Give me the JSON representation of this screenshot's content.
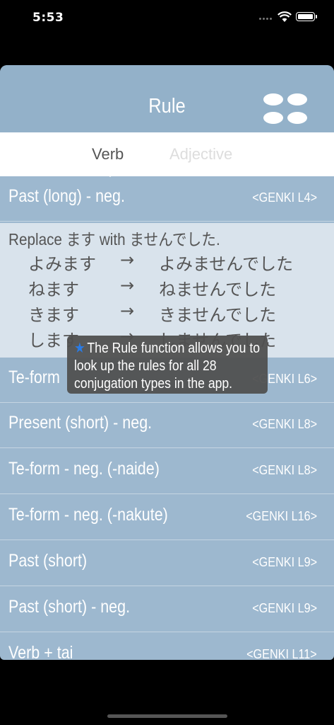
{
  "status": {
    "time": "5:53"
  },
  "nav": {
    "title": "Rule"
  },
  "segments": {
    "verb": "Verb",
    "adjective": "Adjective"
  },
  "rows": [
    {
      "title": "Past (long) - neg.",
      "tag": "<GENKI L4>"
    },
    {
      "title": "Te-form",
      "tag": "<GENKI L6>"
    },
    {
      "title": "Present (short) - neg.",
      "tag": "<GENKI L8>"
    },
    {
      "title": "Te-form - neg. (-naide)",
      "tag": "<GENKI L8>"
    },
    {
      "title": "Te-form - neg. (-nakute)",
      "tag": "<GENKI L16>"
    },
    {
      "title": "Past (short)",
      "tag": "<GENKI L9>"
    },
    {
      "title": "Past (short) - neg.",
      "tag": "<GENKI L9>"
    },
    {
      "title": "Verb + tai",
      "tag": "<GENKI L11>"
    }
  ],
  "rule": {
    "intro": "Replace ます with ませんでした.",
    "examples": [
      {
        "from": "よみます",
        "arrow": "→",
        "to": "よみませんでした"
      },
      {
        "from": "ねます",
        "arrow": "→",
        "to": "ねませんでした"
      },
      {
        "from": "きます",
        "arrow": "→",
        "to": "きませんでした"
      },
      {
        "from": "します",
        "arrow": "→",
        "to": "しませんでした"
      }
    ]
  },
  "tooltip": {
    "text": "The Rule function allows you to look up the rules for all 28 conjugation types in the app."
  }
}
